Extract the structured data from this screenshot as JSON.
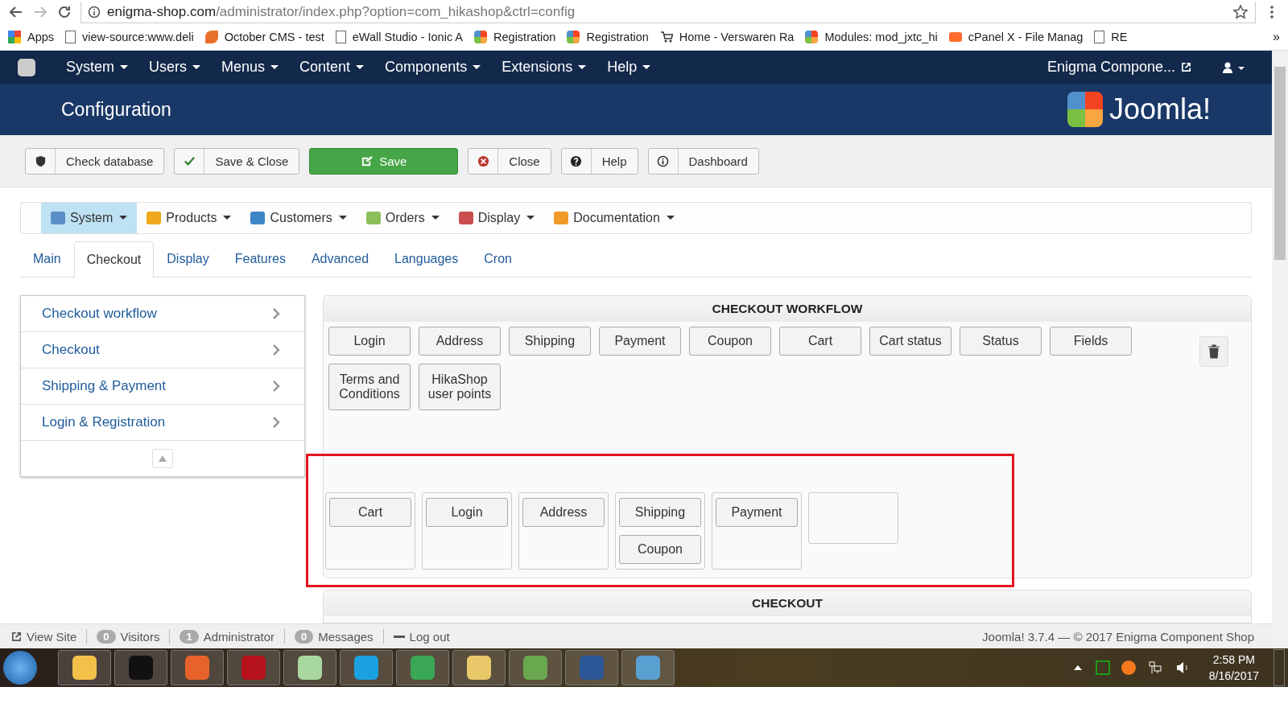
{
  "browser": {
    "url_host": "enigma-shop.com",
    "url_path": "/administrator/index.php?option=com_hikashop&ctrl=config",
    "bookmarks": [
      {
        "kind": "apps",
        "label": "Apps"
      },
      {
        "kind": "page",
        "label": "view-source:www.deli"
      },
      {
        "kind": "leaf",
        "label": "October CMS - test"
      },
      {
        "kind": "page",
        "label": "eWall Studio - Ionic A"
      },
      {
        "kind": "joomla",
        "label": "Registration"
      },
      {
        "kind": "joomla",
        "label": "Registration"
      },
      {
        "kind": "cart",
        "label": "Home - Verswaren Ra"
      },
      {
        "kind": "joomla",
        "label": "Modules: mod_jxtc_hi"
      },
      {
        "kind": "cpanel",
        "label": "cPanel X - File Manag"
      },
      {
        "kind": "page",
        "label": "RE"
      }
    ],
    "more": "»"
  },
  "admin_menu": {
    "items": [
      "System",
      "Users",
      "Menus",
      "Content",
      "Components",
      "Extensions",
      "Help"
    ],
    "site_link": "Enigma Compone..."
  },
  "header": {
    "title": "Configuration",
    "logo_text": "Joomla!"
  },
  "toolbar": [
    {
      "kind": "shield",
      "label": "Check database"
    },
    {
      "kind": "check",
      "label": "Save & Close"
    },
    {
      "kind": "save",
      "label": "Save"
    },
    {
      "kind": "close",
      "label": "Close"
    },
    {
      "kind": "help",
      "label": "Help"
    },
    {
      "kind": "dashboard",
      "label": "Dashboard"
    }
  ],
  "hika_menu": [
    {
      "kind": "tools",
      "label": "System",
      "selected": true
    },
    {
      "kind": "box",
      "label": "Products",
      "selected": false
    },
    {
      "kind": "people",
      "label": "Customers",
      "selected": false
    },
    {
      "kind": "doc",
      "label": "Orders",
      "selected": false
    },
    {
      "kind": "window",
      "label": "Display",
      "selected": false
    },
    {
      "kind": "lifebuoy",
      "label": "Documentation",
      "selected": false
    }
  ],
  "tabs": [
    {
      "label": "Main",
      "selected": false
    },
    {
      "label": "Checkout",
      "selected": true
    },
    {
      "label": "Display",
      "selected": false
    },
    {
      "label": "Features",
      "selected": false
    },
    {
      "label": "Advanced",
      "selected": false
    },
    {
      "label": "Languages",
      "selected": false
    },
    {
      "label": "Cron",
      "selected": false
    }
  ],
  "side_nav": [
    "Checkout workflow",
    "Checkout",
    "Shipping & Payment",
    "Login & Registration"
  ],
  "workflow": {
    "title": "CHECKOUT WORKFLOW",
    "available": [
      "Login",
      "Address",
      "Shipping",
      "Payment",
      "Coupon",
      "Cart",
      "Cart status",
      "Status",
      "Fields",
      "Terms and Conditions",
      "HikaShop user points"
    ],
    "steps": [
      {
        "kind": "step",
        "items": [
          "Cart"
        ]
      },
      {
        "kind": "step",
        "items": [
          "Login"
        ]
      },
      {
        "kind": "step",
        "items": [
          "Address"
        ]
      },
      {
        "kind": "step",
        "items": [
          "Shipping",
          "Coupon"
        ]
      },
      {
        "kind": "step",
        "items": [
          "Payment"
        ]
      },
      {
        "kind": "drop-zone"
      }
    ]
  },
  "checkout_panel": {
    "title": "CHECKOUT"
  },
  "status_bar": {
    "view_site": "View Site",
    "counters": [
      {
        "count": "0",
        "label": "Visitors"
      },
      {
        "count": "1",
        "label": "Administrator"
      },
      {
        "count": "0",
        "label": "Messages"
      }
    ],
    "logout": "Log out",
    "footer": "Joomla! 3.7.4  —  © 2017 Enigma Component Shop"
  },
  "taskbar": {
    "time": "2:58 PM",
    "date": "8/16/2017"
  }
}
